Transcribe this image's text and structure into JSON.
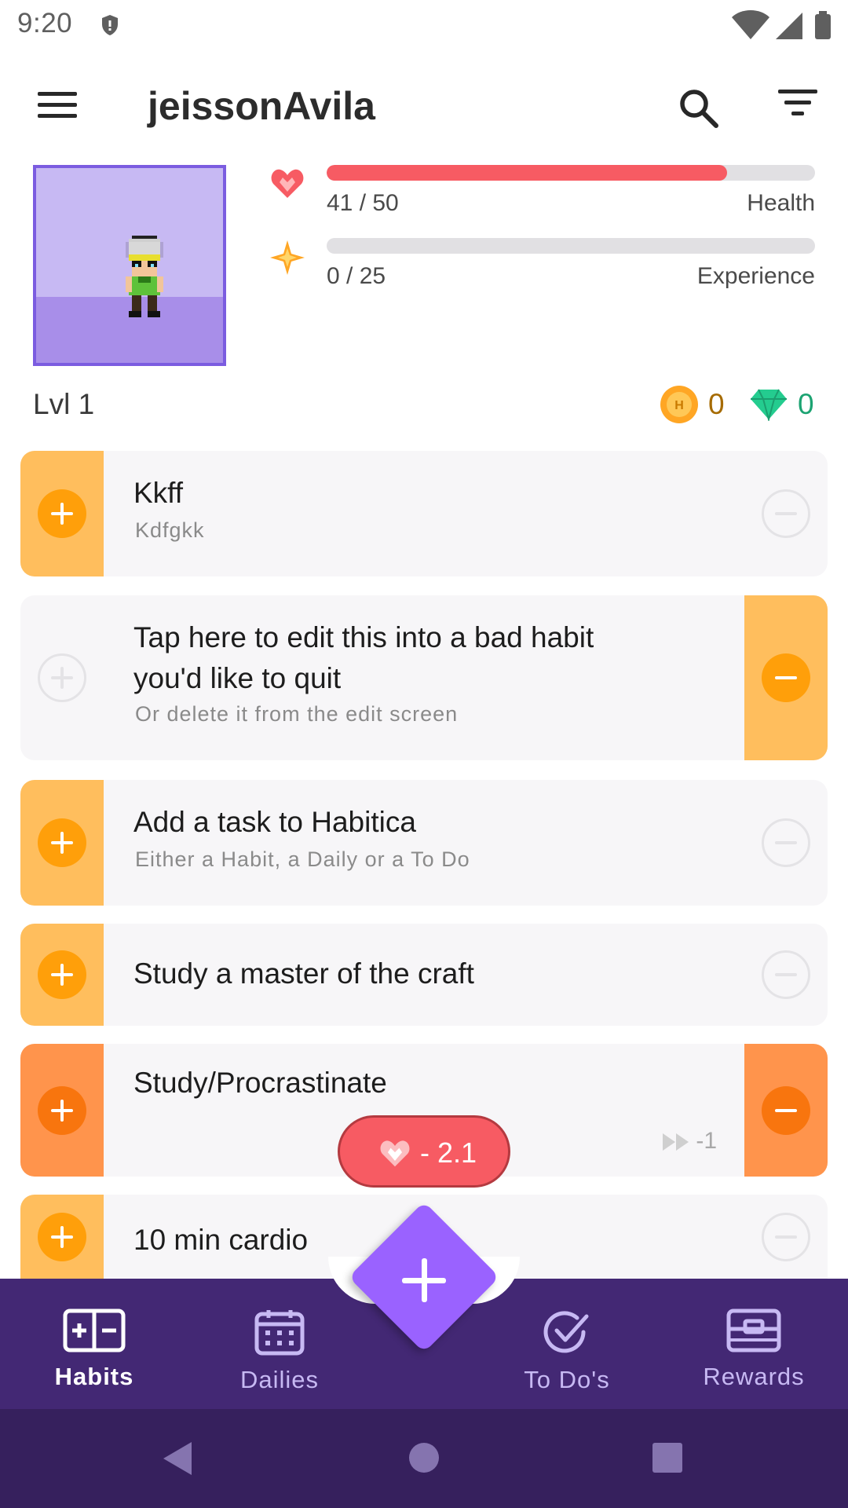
{
  "status_bar": {
    "time": "9:20",
    "icons": [
      "shield-icon",
      "wifi-icon",
      "signal-icon",
      "battery-icon"
    ]
  },
  "app_bar": {
    "title": "jeissonAvila",
    "icons": [
      "menu-icon",
      "search-icon",
      "filter-icon"
    ]
  },
  "stats": {
    "health": {
      "value": "41 / 50",
      "label": "Health",
      "fraction": 0.82,
      "color": "#f75b63",
      "icon": "heart-icon"
    },
    "experience": {
      "value": "0 / 25",
      "label": "Experience",
      "fraction": 0.0,
      "color": "#ffa624",
      "icon": "star-icon"
    }
  },
  "level": "Lvl 1",
  "currency": {
    "gold": "0",
    "gems": "0",
    "gold_color": "#ffa624",
    "gem_color": "#24cc8f"
  },
  "habits": [
    {
      "title": "Kkff",
      "notes": "Kdfgkk",
      "positive": true,
      "negative": false
    },
    {
      "title": "Tap here to edit this into a bad habit you'd like to quit",
      "notes": "Or delete it from the edit screen",
      "positive": false,
      "negative": true
    },
    {
      "title": "Add a task to Habitica",
      "notes": "Either a Habit, a Daily or a To Do",
      "positive": true,
      "negative": false
    },
    {
      "title": "Study a master of the craft",
      "notes": "",
      "positive": true,
      "negative": false
    },
    {
      "title": "Study/Procrastinate",
      "notes": "",
      "positive": true,
      "negative": true,
      "streak": "-1"
    },
    {
      "title": "10 min cardio",
      "notes": "",
      "positive": true,
      "negative": false
    }
  ],
  "toast": {
    "text": "- 2.1",
    "icon": "heart-icon",
    "color": "#f75b63"
  },
  "bottom_nav": {
    "items": [
      {
        "label": "Habits",
        "icon": "habits-icon",
        "active": true
      },
      {
        "label": "Dailies",
        "icon": "calendar-icon",
        "active": false
      },
      {
        "label": "To Do's",
        "icon": "check-circle-icon",
        "active": false
      },
      {
        "label": "Rewards",
        "icon": "rewards-icon",
        "active": false
      }
    ],
    "fab_icon": "plus-icon"
  },
  "system_nav": {
    "icons": [
      "back-icon",
      "home-icon",
      "recents-icon"
    ]
  }
}
